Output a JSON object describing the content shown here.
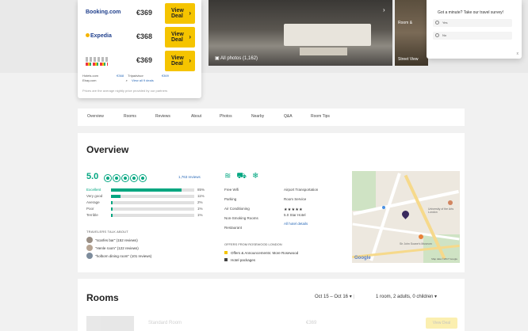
{
  "offers": [
    {
      "provider": "Booking.com",
      "price": "€369",
      "deal_label": "View Deal",
      "color": "#1f3f8c"
    },
    {
      "provider": "Expedia",
      "price": "€368",
      "deal_label": "View Deal",
      "color": "#1f3f8c"
    },
    {
      "provider": "",
      "price": "€369",
      "deal_label": "View Deal",
      "color": "#999999"
    }
  ],
  "card_links": {
    "left_provider": "Hotels.com",
    "left_price": "€368",
    "right_provider": "Tripadvisor",
    "right_price": "€369",
    "line2_left": "Ebay.com",
    "view_all": "View all 9 deals",
    "note": "Prices are the average nightly price provided by our partners"
  },
  "gallery": {
    "all_photos": "All photos (1,162)",
    "side_label_1": "Room &",
    "side_label_2": "Street View"
  },
  "survey": {
    "question": "Got a minute? Take our travel survey!",
    "options": [
      "Yes",
      "No"
    ],
    "close": "x"
  },
  "tabs": [
    "Overview",
    "Rooms",
    "Reviews",
    "About",
    "Photos",
    "Nearby",
    "Q&A",
    "Room Tips"
  ],
  "overview": {
    "title": "Overview",
    "rating": "5.0",
    "reviews_link": "1,763 reviews",
    "breakdown": [
      {
        "label": "Excellent",
        "pct": "85%",
        "fraction": 0.85
      },
      {
        "label": "Very good",
        "pct": "11%",
        "fraction": 0.11
      },
      {
        "label": "Average",
        "pct": "2%",
        "fraction": 0.02
      },
      {
        "label": "Poor",
        "pct": "1%",
        "fraction": 0.01
      },
      {
        "label": "Terrible",
        "pct": "1%",
        "fraction": 0.01
      }
    ],
    "talk_title": "TRAVELERS TALK ABOUT",
    "talk": [
      "\"scarfes bar\" (152 reviews)",
      "\"Henle room\" (122 reviews)",
      "\"holborn dining room\" (101 reviews)"
    ],
    "amenities_left": [
      "Free Wifi",
      "Parking",
      "Air Conditioning",
      "Non-Smoking Rooms",
      "Restaurant"
    ],
    "amenities_right": [
      "Airport Transportation",
      "Room Service"
    ],
    "stars": "★★★★★",
    "star_text": "5.0 Star Hotel",
    "all_details": "All hotel details",
    "offers_title": "OFFERS FROM ROSEWOOD LONDON",
    "offer_lines": [
      "Offers & Announcements: More Rosewood",
      "Hotel packages"
    ],
    "map": {
      "label": "University of the Arts London",
      "label2": "Sir John Soane's Museum",
      "logo": "Google",
      "copyright": "Map data ©2017 Google"
    }
  },
  "rooms": {
    "title": "Rooms",
    "dates": "Oct 15 – Oct 16",
    "guests": "1 room, 2 adults, 0 children",
    "row": {
      "name": "Standard Room",
      "price": "€369",
      "button": "View Deal"
    }
  },
  "accent_color": "#00a680",
  "deal_color": "#f5c400"
}
